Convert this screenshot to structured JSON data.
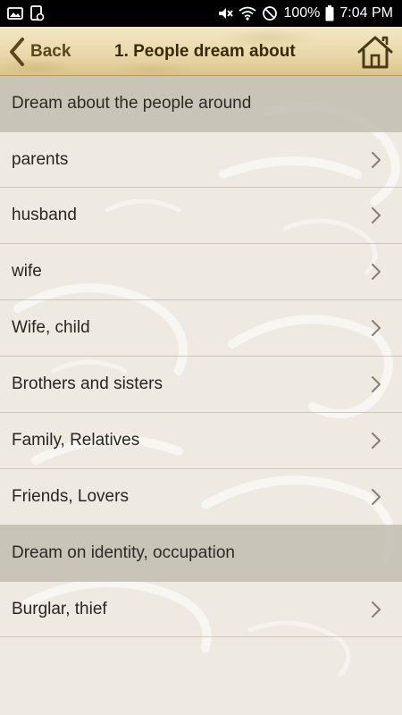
{
  "status_bar": {
    "battery_text": "100%",
    "time": "7:04 PM"
  },
  "app_bar": {
    "back_label": "Back",
    "title": "1. People dream about",
    "back_icon": "chevron-left-icon",
    "home_icon": "home-icon"
  },
  "sections": [
    {
      "header": "Dream about the people around",
      "items": [
        {
          "label": "parents"
        },
        {
          "label": "husband"
        },
        {
          "label": "wife"
        },
        {
          "label": "Wife, child"
        },
        {
          "label": "Brothers and sisters"
        },
        {
          "label": "Family, Relatives"
        },
        {
          "label": "Friends, Lovers"
        }
      ]
    },
    {
      "header": "Dream on identity, occupation",
      "items": [
        {
          "label": "Burglar, thief"
        }
      ]
    }
  ],
  "colors": {
    "app_bar": "#ead9ab",
    "accent_text": "#5a4620",
    "section_header_bg": "#bdb8ad",
    "background": "#eeeae2"
  }
}
